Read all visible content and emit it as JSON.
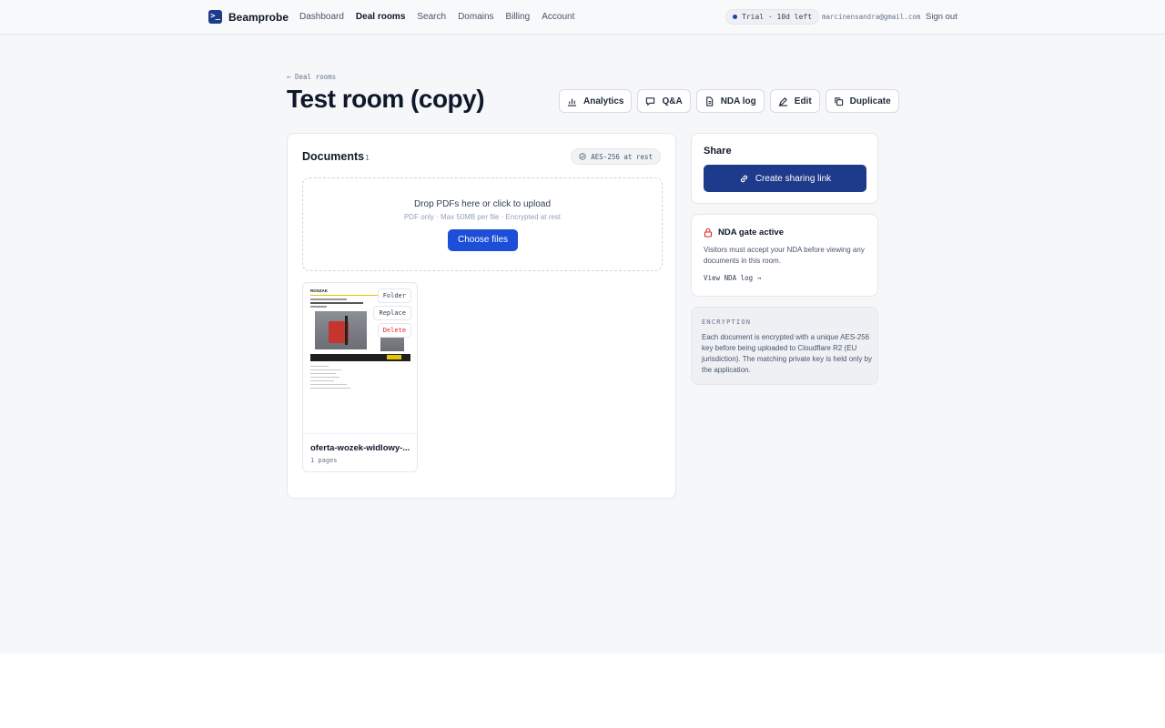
{
  "brand": {
    "name": "Beamprobe",
    "logo_glyph": ">_"
  },
  "nav": {
    "items": [
      "Dashboard",
      "Deal rooms",
      "Search",
      "Domains",
      "Billing",
      "Account"
    ],
    "active": "Deal rooms"
  },
  "account": {
    "trial": "Trial · 10d left",
    "email": "marcinensandra@gmail.com",
    "signout": "Sign out"
  },
  "page": {
    "breadcrumb": "← Deal rooms",
    "title": "Test room (copy)"
  },
  "actions": [
    {
      "label": "Analytics",
      "icon": "bar-chart-icon"
    },
    {
      "label": "Q&A",
      "icon": "chat-icon"
    },
    {
      "label": "NDA log",
      "icon": "document-icon"
    },
    {
      "label": "Edit",
      "icon": "edit-icon"
    },
    {
      "label": "Duplicate",
      "icon": "copy-icon"
    }
  ],
  "documents": {
    "title": "Documents",
    "count": "1",
    "badge": "AES-256 at rest",
    "dropzone": {
      "title": "Drop PDFs here or click to upload",
      "subtitle": "PDF only · Max 50MB per file · Encrypted at rest",
      "button": "Choose files"
    },
    "items": [
      {
        "name": "oferta-wozek-widlowy-...",
        "pages": "1 pages",
        "thumb_brand": "ROSZAK",
        "actions": {
          "folder": "Folder",
          "replace": "Replace",
          "delete": "Delete"
        }
      }
    ]
  },
  "share": {
    "title": "Share",
    "button": "Create sharing link"
  },
  "nda": {
    "title": "NDA gate active",
    "text": "Visitors must accept your NDA before viewing any documents in this room.",
    "link": "View NDA log →"
  },
  "encryption": {
    "title": "ENCRYPTION",
    "text": "Each document is encrypted with a unique AES-256 key before being uploaded to Cloudflare R2 (EU jurisdiction). The matching private key is held only by the application."
  },
  "colors": {
    "brand": "#1e3a8a",
    "primary": "#1d4ed8",
    "danger": "#dc2626",
    "background": "#f6f7f9"
  }
}
